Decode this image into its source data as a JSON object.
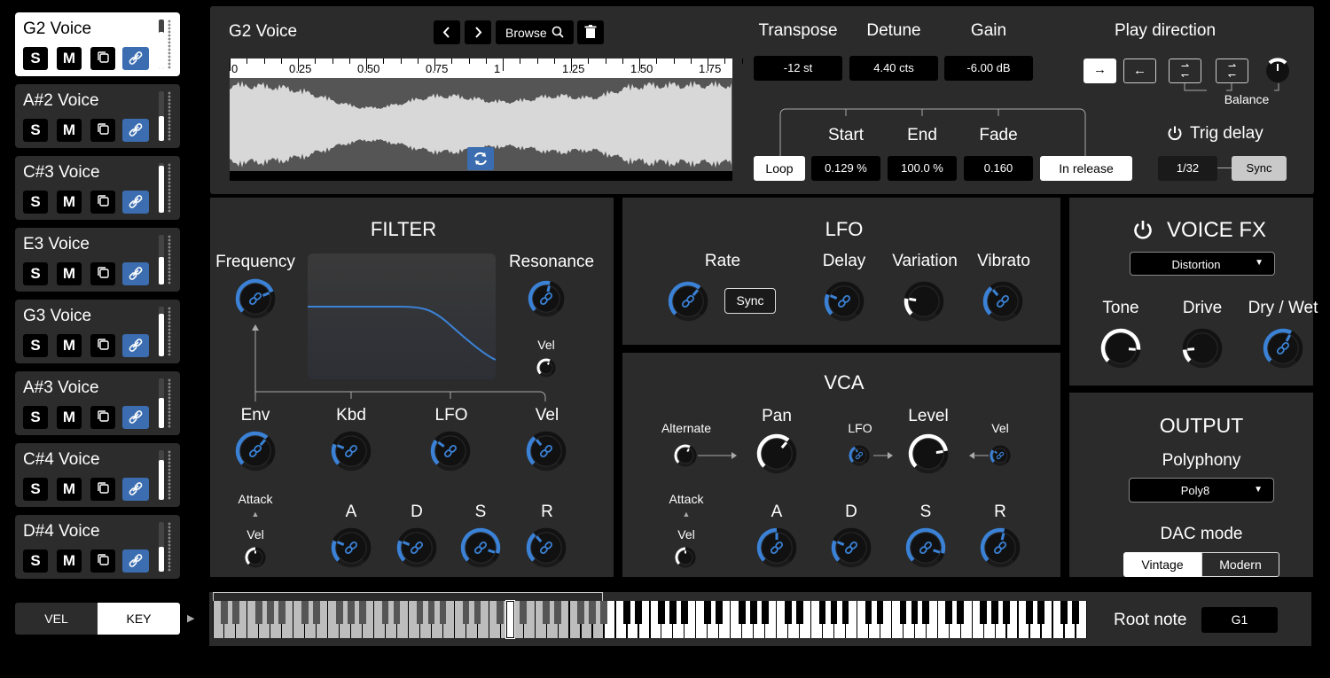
{
  "voices": [
    {
      "name": "G2  Voice",
      "level": 0.75,
      "selected": true
    },
    {
      "name": "A#2 Voice",
      "level": 0.5,
      "selected": false
    },
    {
      "name": "C#3 Voice",
      "level": 0.95,
      "selected": false
    },
    {
      "name": "E3  Voice",
      "level": 0.55,
      "selected": false
    },
    {
      "name": "G3  Voice",
      "level": 0.85,
      "selected": false
    },
    {
      "name": "A#3 Voice",
      "level": 0.6,
      "selected": false
    },
    {
      "name": "C#4 Voice",
      "level": 0.8,
      "selected": false
    },
    {
      "name": "D#4 Voice",
      "level": 0.5,
      "selected": false
    }
  ],
  "voice_buttons": {
    "solo": "S",
    "mute": "M"
  },
  "sample": {
    "title": "G2  Voice",
    "browse": "Browse",
    "ruler": [
      "0",
      "0.25",
      "0.50",
      "0.75",
      "1",
      "1.25",
      "1.50",
      "1.75"
    ]
  },
  "params": {
    "transpose": {
      "label": "Transpose",
      "value": "-12 st"
    },
    "detune": {
      "label": "Detune",
      "value": "4.40 cts"
    },
    "gain": {
      "label": "Gain",
      "value": "-6.00 dB"
    },
    "play_direction": "Play direction",
    "balance": "Balance",
    "loop": "Loop",
    "start": {
      "label": "Start",
      "value": "0.129 %"
    },
    "end": {
      "label": "End",
      "value": "100.0 %"
    },
    "fade": {
      "label": "Fade",
      "value": "0.160"
    },
    "in_release": "In release",
    "trig_delay": {
      "label": "Trig delay",
      "division": "1/32",
      "sync": "Sync"
    }
  },
  "filter": {
    "title": "FILTER",
    "frequency": "Frequency",
    "resonance": "Resonance",
    "vel_small": "Vel",
    "env": "Env",
    "kbd": "Kbd",
    "lfo": "LFO",
    "vel": "Vel",
    "attack": "Attack",
    "attack_vel": "Vel",
    "a": "A",
    "d": "D",
    "s": "S",
    "r": "R"
  },
  "lfo": {
    "title": "LFO",
    "rate": "Rate",
    "sync": "Sync",
    "delay": "Delay",
    "variation": "Variation",
    "vibrato": "Vibrato"
  },
  "vca": {
    "title": "VCA",
    "alternate": "Alternate",
    "pan": "Pan",
    "lfo": "LFO",
    "level": "Level",
    "vel": "Vel",
    "attack": "Attack",
    "attack_vel": "Vel",
    "a": "A",
    "d": "D",
    "s": "S",
    "r": "R"
  },
  "voice_fx": {
    "title": "VOICE FX",
    "type": "Distortion",
    "tone": "Tone",
    "drive": "Drive",
    "drywet": "Dry / Wet"
  },
  "output": {
    "title": "OUTPUT",
    "polyphony_label": "Polyphony",
    "polyphony": "Poly8",
    "dac_label": "DAC mode",
    "vintage": "Vintage",
    "modern": "Modern"
  },
  "keyboard": {
    "vel": "VEL",
    "key": "KEY",
    "root_label": "Root note",
    "root": "G1"
  },
  "colors": {
    "accent": "#3b82d6",
    "panel": "#2b2b2b",
    "link_button": "#3b6db0"
  }
}
